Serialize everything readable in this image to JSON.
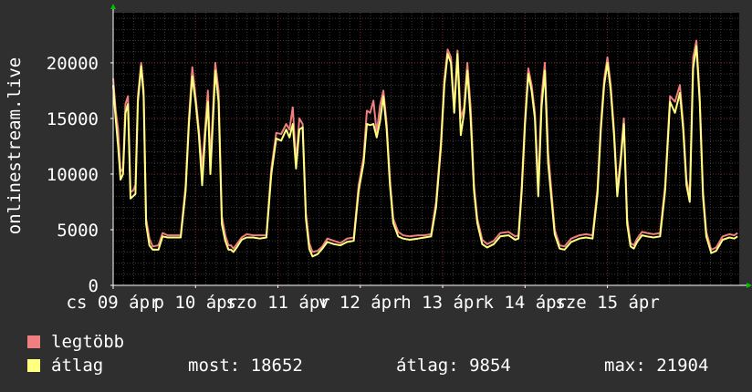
{
  "chart_data": {
    "type": "line",
    "ylabel": "onlinestream.live",
    "ylim": [
      0,
      24500
    ],
    "yticks": [
      0,
      5000,
      10000,
      15000,
      20000
    ],
    "xlim": [
      0,
      7.6
    ],
    "xticks": [
      {
        "x": 0.0,
        "label": "cs 09 ápr"
      },
      {
        "x": 1.0,
        "label": "p 10 ápr"
      },
      {
        "x": 2.0,
        "label": "szo 11 ápr"
      },
      {
        "x": 3.0,
        "label": "v 12 ápr"
      },
      {
        "x": 4.0,
        "label": "h 13 ápr"
      },
      {
        "x": 5.0,
        "label": "k 14 ápr"
      },
      {
        "x": 6.0,
        "label": "sze 15 ápr"
      }
    ],
    "x": [
      0.0,
      0.03,
      0.06,
      0.09,
      0.12,
      0.15,
      0.18,
      0.21,
      0.24,
      0.27,
      0.3,
      0.34,
      0.37,
      0.4,
      0.44,
      0.48,
      0.55,
      0.6,
      0.66,
      0.72,
      0.82,
      0.88,
      0.92,
      0.96,
      1.0,
      1.04,
      1.08,
      1.12,
      1.15,
      1.18,
      1.21,
      1.24,
      1.28,
      1.32,
      1.36,
      1.4,
      1.43,
      1.46,
      1.5,
      1.56,
      1.62,
      1.7,
      1.78,
      1.86,
      1.92,
      1.98,
      2.04,
      2.1,
      2.14,
      2.18,
      2.22,
      2.26,
      2.3,
      2.34,
      2.38,
      2.42,
      2.48,
      2.54,
      2.6,
      2.68,
      2.76,
      2.84,
      2.92,
      2.98,
      3.04,
      3.08,
      3.12,
      3.16,
      3.2,
      3.24,
      3.28,
      3.32,
      3.36,
      3.4,
      3.46,
      3.52,
      3.6,
      3.7,
      3.78,
      3.86,
      3.92,
      3.98,
      4.02,
      4.06,
      4.1,
      4.14,
      4.18,
      4.22,
      4.26,
      4.3,
      4.34,
      4.38,
      4.42,
      4.48,
      4.54,
      4.62,
      4.7,
      4.8,
      4.88,
      4.92,
      4.96,
      5.0,
      5.04,
      5.08,
      5.12,
      5.16,
      5.2,
      5.24,
      5.28,
      5.32,
      5.36,
      5.42,
      5.48,
      5.56,
      5.66,
      5.74,
      5.82,
      5.88,
      5.92,
      5.96,
      6.0,
      6.04,
      6.08,
      6.12,
      6.16,
      6.2,
      6.24,
      6.28,
      6.32,
      6.36,
      6.42,
      6.48,
      6.56,
      6.64,
      6.7,
      6.76,
      6.82,
      6.88,
      6.92,
      6.96,
      7.0,
      7.04,
      7.08,
      7.12,
      7.16,
      7.2,
      7.26,
      7.32,
      7.4,
      7.48,
      7.54,
      7.58
    ],
    "series": [
      {
        "name": "legtöbb",
        "color": "#f07f7f",
        "values": [
          18600,
          15800,
          14000,
          10200,
          10500,
          16300,
          17000,
          8400,
          8500,
          9000,
          17000,
          20000,
          17500,
          6000,
          4200,
          3500,
          3600,
          4700,
          4500,
          4500,
          4500,
          9000,
          15000,
          19600,
          17000,
          14000,
          10500,
          14500,
          17500,
          11000,
          15500,
          20000,
          17500,
          6200,
          4500,
          3600,
          3600,
          3300,
          3700,
          4300,
          4600,
          4500,
          4500,
          4500,
          10500,
          13700,
          13600,
          14500,
          14000,
          16000,
          11000,
          15000,
          14500,
          6500,
          3800,
          3000,
          3100,
          3500,
          4200,
          4000,
          3800,
          4200,
          4300,
          9000,
          11500,
          15700,
          15500,
          16600,
          13700,
          16200,
          17500,
          14500,
          9500,
          6000,
          4800,
          4500,
          4400,
          4500,
          4500,
          4600,
          7500,
          13000,
          18500,
          21200,
          20500,
          16000,
          21100,
          15000,
          16000,
          20000,
          16000,
          9000,
          6000,
          4100,
          3700,
          4000,
          4700,
          4800,
          4400,
          4500,
          9000,
          15000,
          19500,
          18000,
          15500,
          9000,
          17000,
          20000,
          12000,
          8500,
          5000,
          3600,
          3500,
          4200,
          4500,
          4600,
          4500,
          8700,
          14500,
          18500,
          20500,
          18000,
          14000,
          8500,
          11500,
          15000,
          6000,
          3800,
          3600,
          4200,
          4800,
          4700,
          4600,
          4700,
          9000,
          17000,
          16500,
          18000,
          14500,
          9500,
          8000,
          20500,
          22000,
          17000,
          8500,
          4800,
          3200,
          3400,
          4400,
          4600,
          4500,
          4700,
          15000,
          19500
        ]
      },
      {
        "name": "átlag",
        "color": "#ffff80",
        "values": [
          18000,
          15000,
          12500,
          9500,
          10000,
          15500,
          16300,
          7800,
          8000,
          8200,
          16500,
          19700,
          17000,
          5500,
          3600,
          3200,
          3200,
          4400,
          4300,
          4300,
          4300,
          8500,
          14500,
          18800,
          16500,
          13500,
          9000,
          13800,
          16500,
          10000,
          14500,
          19300,
          16500,
          5500,
          4000,
          3200,
          3200,
          3000,
          3400,
          4100,
          4300,
          4300,
          4200,
          4300,
          10000,
          13200,
          13000,
          14000,
          13300,
          14500,
          10500,
          14000,
          14200,
          6000,
          3300,
          2600,
          2800,
          3300,
          3900,
          3700,
          3600,
          3900,
          4000,
          8500,
          11000,
          14500,
          14400,
          14500,
          13300,
          14800,
          17000,
          14000,
          9000,
          5600,
          4400,
          4200,
          4100,
          4200,
          4300,
          4400,
          7000,
          12500,
          18000,
          20800,
          20000,
          15500,
          20800,
          13500,
          15500,
          19300,
          15000,
          8500,
          5600,
          3700,
          3400,
          3700,
          4400,
          4500,
          4100,
          4200,
          8500,
          14500,
          19000,
          17500,
          15000,
          8000,
          16000,
          19300,
          11000,
          7800,
          4600,
          3300,
          3200,
          3900,
          4200,
          4300,
          4200,
          8200,
          14000,
          18000,
          20000,
          17500,
          13500,
          8000,
          11000,
          14500,
          5500,
          3500,
          3300,
          3900,
          4500,
          4400,
          4300,
          4400,
          8500,
          16500,
          15500,
          17300,
          14000,
          9000,
          7500,
          19500,
          21500,
          16500,
          8000,
          4400,
          2900,
          3100,
          4100,
          4300,
          4200,
          4400,
          14500,
          18600
        ]
      }
    ]
  },
  "legend": [
    {
      "label": "legtöbb",
      "color": "#f07f7f"
    },
    {
      "label": "átlag",
      "color": "#ffff80"
    }
  ],
  "stats": {
    "most_label": "most:",
    "most_value": "18652",
    "atlag_label": "átlag:",
    "atlag_value": "9854",
    "max_label": "max:",
    "max_value": "21904"
  },
  "colors": {
    "background": "#2f2f2f",
    "plot_area": "#000000",
    "grid": "#444444",
    "axis": "#ffffff"
  }
}
